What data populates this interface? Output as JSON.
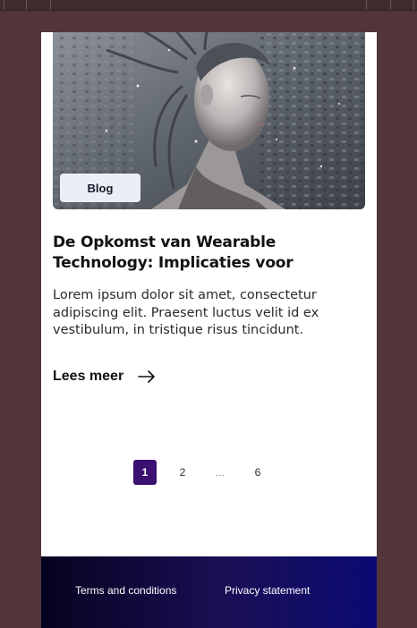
{
  "card": {
    "tag": "Blog",
    "title": "De Opkomst van Wearable Technology: Implicaties voor",
    "excerpt": "Lorem ipsum dolor sit amet, consectetur adipiscing elit. Praesent luctus velit id ex vestibulum, in tristique risus tincidunt.",
    "read_more": "Lees meer",
    "read_more_icon": "arrow-right-icon",
    "image": "cyborg-woman-illustration"
  },
  "pagination": {
    "pages": [
      "1",
      "2",
      "...",
      "6"
    ],
    "current": "1",
    "active_color": "#3b1070"
  },
  "footer": {
    "links": [
      "Terms and conditions",
      "Privacy statement"
    ]
  },
  "colors": {
    "background": "#523539",
    "surface": "#ffffff",
    "tag_background": "#eceef7"
  }
}
